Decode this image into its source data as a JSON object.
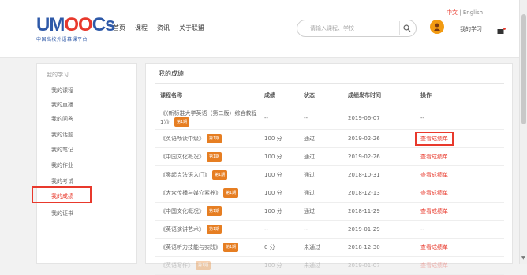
{
  "header": {
    "logo_main": "UMOOCs",
    "logo_sub": "中国高校外语慕课平台",
    "nav": [
      "首页",
      "课程",
      "资讯",
      "关于联盟"
    ],
    "search_placeholder": "请输入课程、学校",
    "lang_cn": "中文",
    "lang_sep": "|",
    "lang_en": "English",
    "my_study": "我的学习"
  },
  "sidebar": {
    "title": "我的学习",
    "items": [
      "我的课程",
      "我的直播",
      "我的问答",
      "我的话题",
      "我的笔记",
      "我的作业",
      "我的考试",
      "我的成绩",
      "我的证书"
    ],
    "active_index": 7
  },
  "main": {
    "title": "我的成绩",
    "headers": [
      "课程名称",
      "成绩",
      "状态",
      "成绩发布时间",
      "操作"
    ],
    "rows": [
      {
        "course": "《〈新标准大学英语（第二版）综合教程1〉》",
        "tag": "第1期",
        "score": "--",
        "status": "--",
        "date": "2019-06-07",
        "op": "--"
      },
      {
        "course": "《英语畅读中级》",
        "tag": "第1期",
        "score": "100 分",
        "status": "通过",
        "date": "2019-02-26",
        "op": "查看成绩单"
      },
      {
        "course": "《中国文化概况》",
        "tag": "第1期",
        "score": "100 分",
        "status": "通过",
        "date": "2019-02-26",
        "op": "查看成绩单"
      },
      {
        "course": "《零起点法语入门》",
        "tag": "第1期",
        "score": "100 分",
        "status": "通过",
        "date": "2018-10-31",
        "op": "查看成绩单"
      },
      {
        "course": "《大众传播与媒介素养》",
        "tag": "第1期",
        "score": "100 分",
        "status": "通过",
        "date": "2018-12-13",
        "op": "查看成绩单"
      },
      {
        "course": "《中国文化概况》",
        "tag": "第1期",
        "score": "100 分",
        "status": "通过",
        "date": "2018-11-29",
        "op": "查看成绩单"
      },
      {
        "course": "《英语演讲艺术》",
        "tag": "第1期",
        "score": "--",
        "status": "--",
        "date": "2019-01-29",
        "op": "--"
      },
      {
        "course": "《英语听力技能与实践》",
        "tag": "第1期",
        "score": "0 分",
        "status": "未通过",
        "date": "2018-12-30",
        "op": "查看成绩单"
      },
      {
        "course": "《英语写作》",
        "tag": "第1期",
        "score": "100 分",
        "status": "未通过",
        "date": "2019-01-07",
        "op": "查看成绩单"
      }
    ]
  },
  "colors": {
    "accent_red": "#e8392c",
    "tag_orange": "#e67e22",
    "brand_blue": "#2e59a8",
    "avatar_orange": "#f29b12"
  },
  "icons": [
    "search-icon",
    "avatar-icon",
    "message-icon",
    "scroll-down-icon"
  ]
}
